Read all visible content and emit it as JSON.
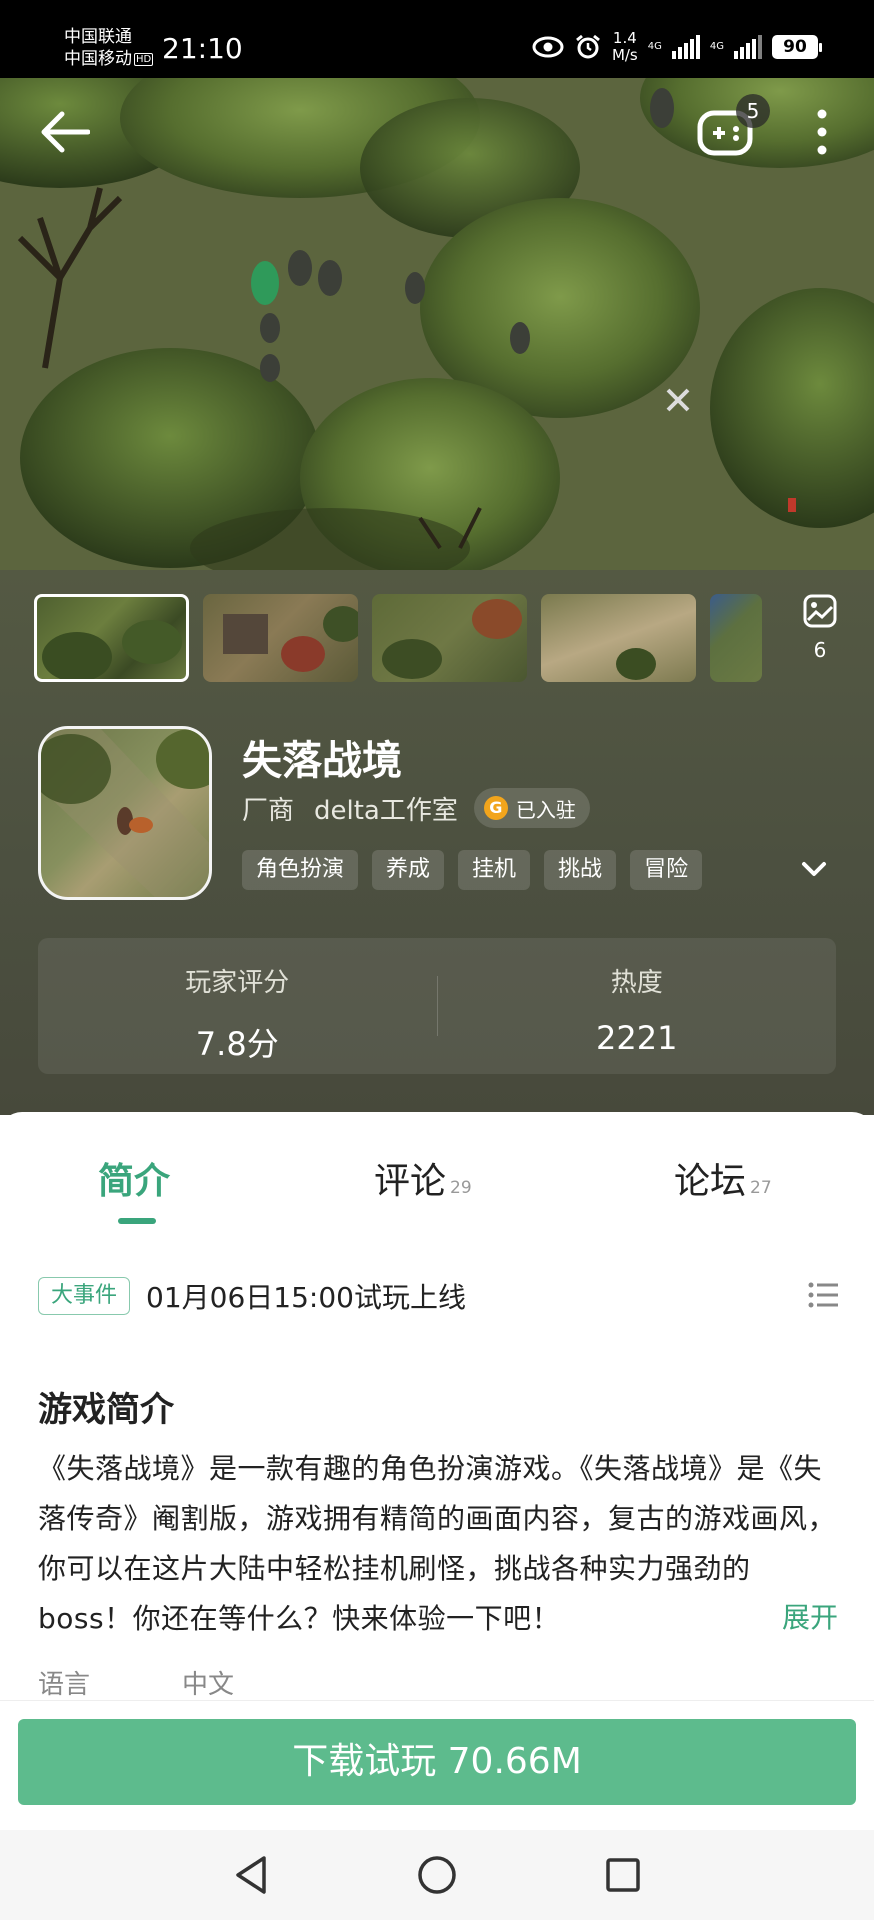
{
  "status_bar": {
    "carrier_1": "中国联通",
    "carrier_2": "中国移动",
    "hd": "HD",
    "time": "21:10",
    "speed_value": "1.4",
    "speed_unit": "M/s",
    "signal_1": "4G",
    "signal_2": "4G",
    "battery": "90"
  },
  "hero": {
    "game_badge_count": "5",
    "icons": [
      "back-arrow-icon",
      "gamepad-icon",
      "more-vertical-icon"
    ]
  },
  "gallery": {
    "count": "6"
  },
  "app": {
    "name": "失落战境",
    "developer_label": "厂商",
    "developer_name": "delta工作室",
    "settled_label": "已入驻",
    "settled_mark": "G",
    "tags": [
      "角色扮演",
      "养成",
      "挂机",
      "挑战",
      "冒险"
    ]
  },
  "stats": {
    "rating_label": "玩家评分",
    "rating_value": "7.8分",
    "heat_label": "热度",
    "heat_value": "2221"
  },
  "tabs": [
    {
      "label": "简介",
      "count": ""
    },
    {
      "label": "评论",
      "count": "29"
    },
    {
      "label": "论坛",
      "count": "27"
    }
  ],
  "event": {
    "badge": "大事件",
    "text": "01月06日15:00试玩上线"
  },
  "intro": {
    "title": "游戏简介",
    "body": "《失落战境》是一款有趣的角色扮演游戏。《失落战境》是《失落传奇》阉割版，游戏拥有精简的画面内容，复古的游戏画风，你可以在这片大陆中轻松挂机刷怪，挑战各种实力强劲的boss！你还在等什么？快来体验一下吧！",
    "expand_label": "展开",
    "language_label": "语言",
    "language_value": "中文"
  },
  "download": {
    "label": "下载试玩 70.66M"
  },
  "colors": {
    "accent": "#3aa57c",
    "download_button": "#5dbb8d",
    "panel_bg": "#4c5040"
  }
}
